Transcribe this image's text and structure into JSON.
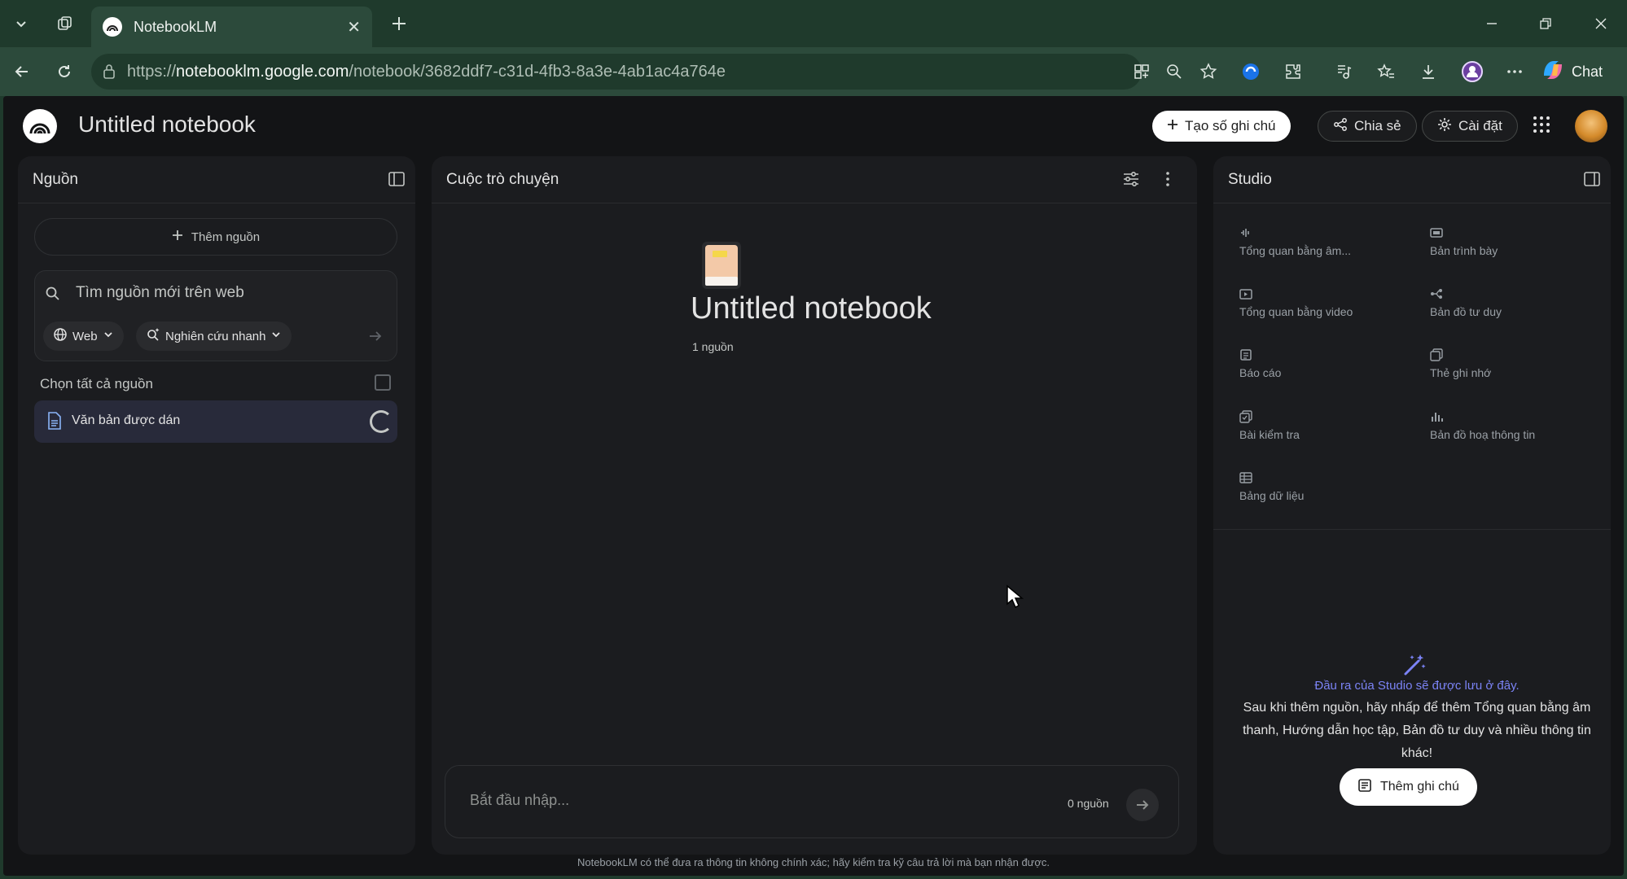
{
  "browser": {
    "tab_title": "NotebookLM",
    "url_prefix": "https://",
    "url_host": "notebooklm.google.com",
    "url_path": "/notebook/3682ddf7-c31d-4fb3-8a3e-4ab1ac4a764e",
    "chat_label": "Chat"
  },
  "header": {
    "title": "Untitled notebook",
    "create_note_label": "Tạo số ghi chú",
    "share_label": "Chia sẻ",
    "settings_label": "Cài đặt"
  },
  "sources": {
    "title": "Nguồn",
    "add_source_label": "Thêm nguồn",
    "search_placeholder": "Tìm nguồn mới trên web",
    "web_chip": "Web",
    "research_chip": "Nghiên cứu nhanh",
    "select_all_label": "Chọn tất cả nguồn",
    "items": [
      {
        "name": "Văn bản được dán",
        "status": "loading"
      }
    ]
  },
  "chat": {
    "title": "Cuộc trò chuyện",
    "notebook_title": "Untitled notebook",
    "source_count": "1 nguồn",
    "input_placeholder": "Bắt đầu nhập...",
    "input_source_count": "0 nguồn"
  },
  "studio": {
    "title": "Studio",
    "tools": [
      {
        "label": "Tổng quan bằng âm...",
        "icon": "audio-waveform-icon"
      },
      {
        "label": "Bản trình bày",
        "icon": "slides-icon"
      },
      {
        "label": "Tổng quan bằng video",
        "icon": "video-icon"
      },
      {
        "label": "Bản đồ tư duy",
        "icon": "mind-map-icon"
      },
      {
        "label": "Báo cáo",
        "icon": "report-icon"
      },
      {
        "label": "Thẻ ghi nhớ",
        "icon": "flashcards-icon"
      },
      {
        "label": "Bài kiểm tra",
        "icon": "quiz-icon"
      },
      {
        "label": "Bản đồ hoạ thông tin",
        "icon": "infographic-icon"
      },
      {
        "label": "Bảng dữ liệu",
        "icon": "data-table-icon"
      }
    ],
    "hint": "Đầu ra của Studio sẽ được lưu ở đây.",
    "description": "Sau khi thêm nguồn, hãy nhấp để thêm Tổng quan bằng âm thanh, Hướng dẫn học tập, Bản đồ tư duy và nhiều thông tin khác!",
    "add_note_label": "Thêm ghi chú"
  },
  "footer": "NotebookLM có thể đưa ra thông tin không chính xác; hãy kiểm tra kỹ câu trả lời mà bạn nhận được.",
  "colors": {
    "browser_chrome": "#1f3a2c",
    "app_background": "#131416",
    "panel_background": "#1b1c1f",
    "studio_hint": "#7b83f5",
    "selected_source": "#282a3a"
  }
}
